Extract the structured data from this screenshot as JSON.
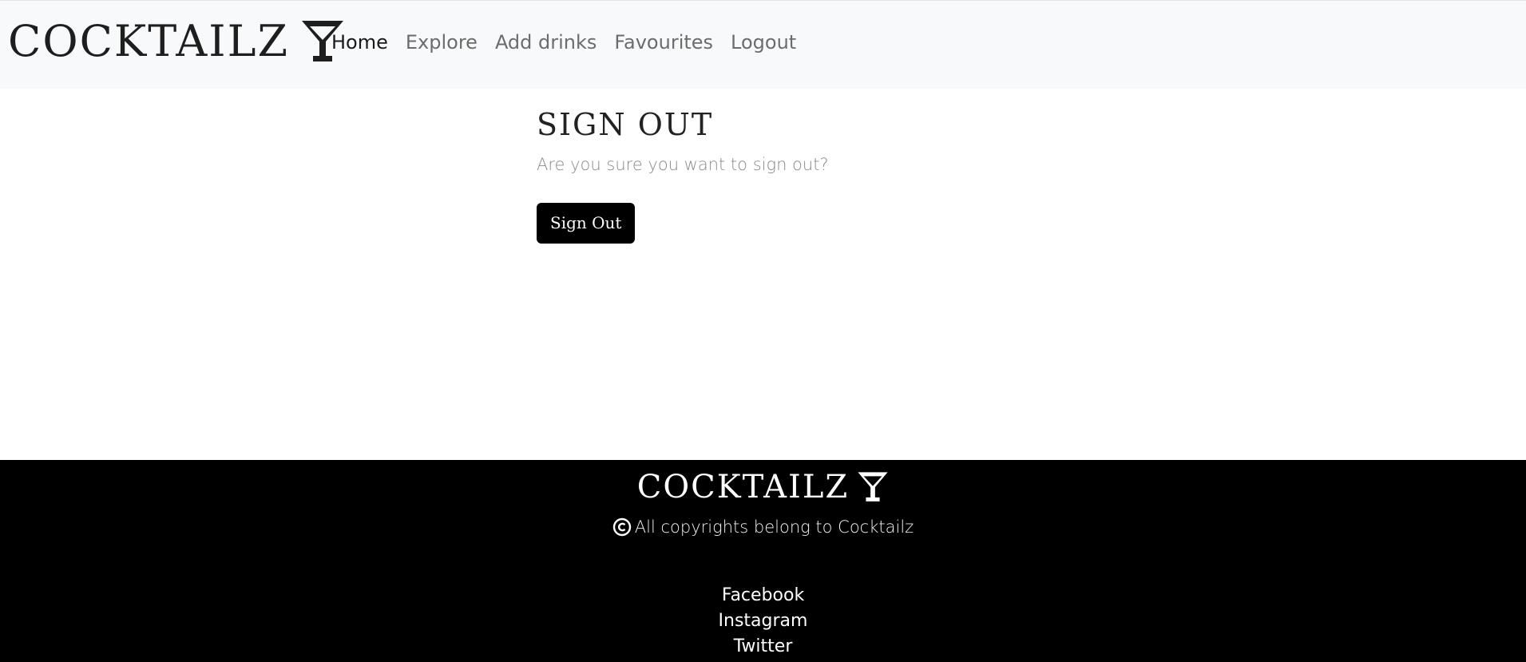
{
  "navbar": {
    "brand": "COCKTAILZ",
    "brand_icon": "cocktail-glass-icon",
    "links": [
      {
        "label": "Home",
        "active": true
      },
      {
        "label": "Explore",
        "active": false
      },
      {
        "label": "Add drinks",
        "active": false
      },
      {
        "label": "Favourites",
        "active": false
      },
      {
        "label": "Logout",
        "active": false
      }
    ]
  },
  "main": {
    "title": "SIGN OUT",
    "subtitle": "Are you sure you want to sign out?",
    "button_label": "Sign Out"
  },
  "footer": {
    "brand": "COCKTAILZ",
    "brand_icon": "cocktail-glass-icon",
    "copyright_icon": "copyright-icon",
    "copyright_text": "All copyrights belong to Cocktailz",
    "social_links": [
      "Facebook",
      "Instagram",
      "Twitter"
    ]
  },
  "colors": {
    "navbar_bg": "#f8f9fa",
    "footer_bg": "#000000",
    "button_bg": "#000000",
    "nav_active": "#1a1a1a",
    "nav_inactive": "#6c6c6c"
  }
}
